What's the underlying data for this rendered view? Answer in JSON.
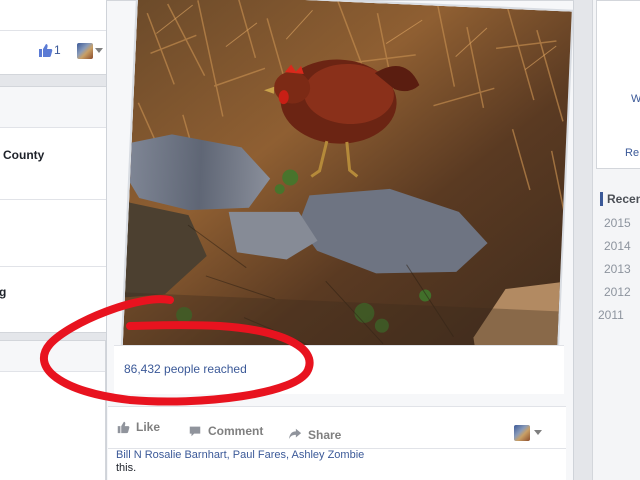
{
  "left_panel": {
    "like_count": "1",
    "item_county": "County",
    "item_partial": "g"
  },
  "post": {
    "reach_text": "86,432 people reached",
    "actions": [
      {
        "label": "Like",
        "icon": "thumbs-up-icon"
      },
      {
        "label": "Comment",
        "icon": "speech-bubble-icon"
      },
      {
        "label": "Share",
        "icon": "share-arrow-icon"
      }
    ],
    "likes_line": {
      "names": [
        "Bill N Rosalie Barnhart",
        "Paul Fares",
        "Ashley Zombie"
      ],
      "suffix": "this."
    }
  },
  "right_panel": {
    "letters": [
      "W",
      "Re"
    ],
    "recent_label": "Recen",
    "years": [
      "2015",
      "2014",
      "2013",
      "2012",
      "2011"
    ]
  },
  "colors": {
    "link": "#3b5998",
    "annotation": "#e8131f"
  }
}
